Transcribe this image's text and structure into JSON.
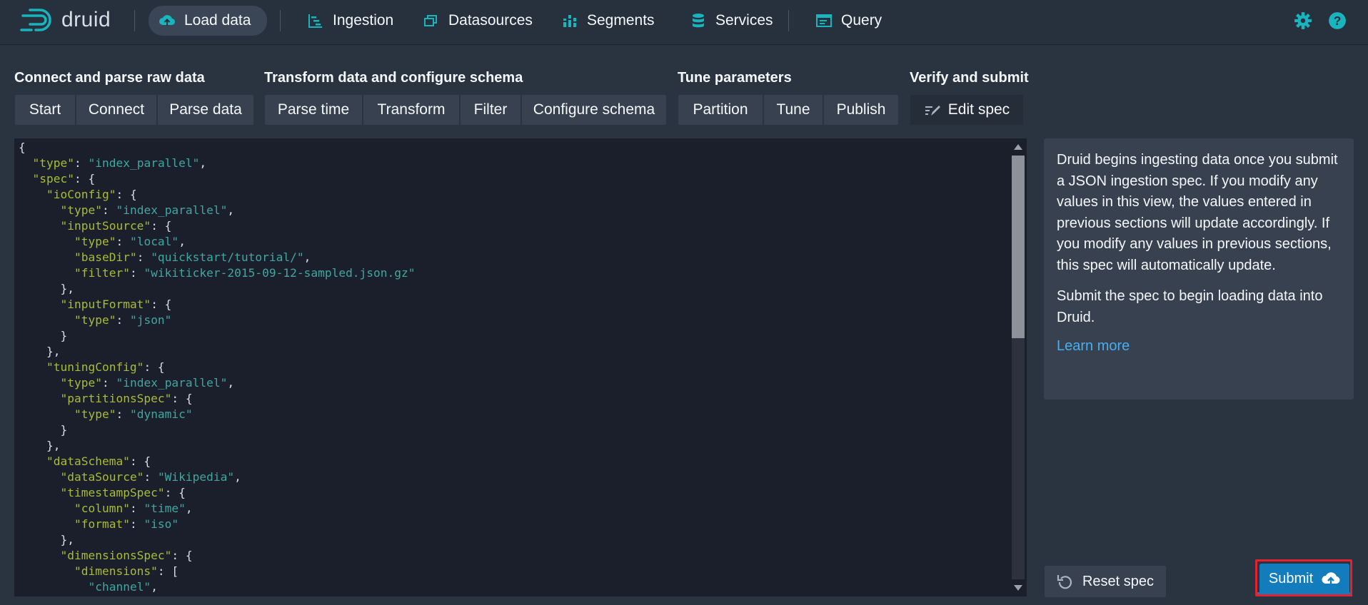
{
  "app": {
    "logo_text": "druid",
    "accent_color": "#48aff0",
    "teal_color": "#19b4bd"
  },
  "nav": {
    "load_data": "Load data",
    "ingestion": "Ingestion",
    "datasources": "Datasources",
    "segments": "Segments",
    "services": "Services",
    "query": "Query",
    "right_icons": [
      "gear-icon",
      "help-icon"
    ]
  },
  "steps": {
    "connect": {
      "title": "Connect and parse raw data",
      "buttons": [
        "Start",
        "Connect",
        "Parse data"
      ]
    },
    "transform": {
      "title": "Transform data and configure schema",
      "buttons": [
        "Parse time",
        "Transform",
        "Filter",
        "Configure schema"
      ]
    },
    "tune": {
      "title": "Tune parameters",
      "buttons": [
        "Partition",
        "Tune",
        "Publish"
      ]
    },
    "verify": {
      "title": "Verify and submit",
      "buttons": [
        "Edit spec"
      ]
    }
  },
  "editor": {
    "lines": [
      [
        [
          "p",
          "{"
        ]
      ],
      [
        [
          "p",
          "  "
        ],
        [
          "k",
          "\"type\""
        ],
        [
          "p",
          ": "
        ],
        [
          "s",
          "\"index_parallel\""
        ],
        [
          "p",
          ","
        ]
      ],
      [
        [
          "p",
          "  "
        ],
        [
          "k",
          "\"spec\""
        ],
        [
          "p",
          ": {"
        ]
      ],
      [
        [
          "p",
          "    "
        ],
        [
          "k",
          "\"ioConfig\""
        ],
        [
          "p",
          ": {"
        ]
      ],
      [
        [
          "p",
          "      "
        ],
        [
          "k",
          "\"type\""
        ],
        [
          "p",
          ": "
        ],
        [
          "s",
          "\"index_parallel\""
        ],
        [
          "p",
          ","
        ]
      ],
      [
        [
          "p",
          "      "
        ],
        [
          "k",
          "\"inputSource\""
        ],
        [
          "p",
          ": {"
        ]
      ],
      [
        [
          "p",
          "        "
        ],
        [
          "k",
          "\"type\""
        ],
        [
          "p",
          ": "
        ],
        [
          "s",
          "\"local\""
        ],
        [
          "p",
          ","
        ]
      ],
      [
        [
          "p",
          "        "
        ],
        [
          "k",
          "\"baseDir\""
        ],
        [
          "p",
          ": "
        ],
        [
          "s",
          "\"quickstart/tutorial/\""
        ],
        [
          "p",
          ","
        ]
      ],
      [
        [
          "p",
          "        "
        ],
        [
          "k",
          "\"filter\""
        ],
        [
          "p",
          ": "
        ],
        [
          "s",
          "\"wikiticker-2015-09-12-sampled.json.gz\""
        ]
      ],
      [
        [
          "p",
          "      },"
        ]
      ],
      [
        [
          "p",
          "      "
        ],
        [
          "k",
          "\"inputFormat\""
        ],
        [
          "p",
          ": {"
        ]
      ],
      [
        [
          "p",
          "        "
        ],
        [
          "k",
          "\"type\""
        ],
        [
          "p",
          ": "
        ],
        [
          "s",
          "\"json\""
        ]
      ],
      [
        [
          "p",
          "      }"
        ]
      ],
      [
        [
          "p",
          "    },"
        ]
      ],
      [
        [
          "p",
          "    "
        ],
        [
          "k",
          "\"tuningConfig\""
        ],
        [
          "p",
          ": {"
        ]
      ],
      [
        [
          "p",
          "      "
        ],
        [
          "k",
          "\"type\""
        ],
        [
          "p",
          ": "
        ],
        [
          "s",
          "\"index_parallel\""
        ],
        [
          "p",
          ","
        ]
      ],
      [
        [
          "p",
          "      "
        ],
        [
          "k",
          "\"partitionsSpec\""
        ],
        [
          "p",
          ": {"
        ]
      ],
      [
        [
          "p",
          "        "
        ],
        [
          "k",
          "\"type\""
        ],
        [
          "p",
          ": "
        ],
        [
          "s",
          "\"dynamic\""
        ]
      ],
      [
        [
          "p",
          "      }"
        ]
      ],
      [
        [
          "p",
          "    },"
        ]
      ],
      [
        [
          "p",
          "    "
        ],
        [
          "k",
          "\"dataSchema\""
        ],
        [
          "p",
          ": {"
        ]
      ],
      [
        [
          "p",
          "      "
        ],
        [
          "k",
          "\"dataSource\""
        ],
        [
          "p",
          ": "
        ],
        [
          "s",
          "\"Wikipedia\""
        ],
        [
          "p",
          ","
        ]
      ],
      [
        [
          "p",
          "      "
        ],
        [
          "k",
          "\"timestampSpec\""
        ],
        [
          "p",
          ": {"
        ]
      ],
      [
        [
          "p",
          "        "
        ],
        [
          "k",
          "\"column\""
        ],
        [
          "p",
          ": "
        ],
        [
          "s",
          "\"time\""
        ],
        [
          "p",
          ","
        ]
      ],
      [
        [
          "p",
          "        "
        ],
        [
          "k",
          "\"format\""
        ],
        [
          "p",
          ": "
        ],
        [
          "s",
          "\"iso\""
        ]
      ],
      [
        [
          "p",
          "      },"
        ]
      ],
      [
        [
          "p",
          "      "
        ],
        [
          "k",
          "\"dimensionsSpec\""
        ],
        [
          "p",
          ": {"
        ]
      ],
      [
        [
          "p",
          "        "
        ],
        [
          "k",
          "\"dimensions\""
        ],
        [
          "p",
          ": ["
        ]
      ],
      [
        [
          "p",
          "          "
        ],
        [
          "s",
          "\"channel\""
        ],
        [
          "p",
          ","
        ]
      ]
    ],
    "scroll_position": 0
  },
  "info": {
    "paragraph1": "Druid begins ingesting data once you submit a JSON ingestion spec. If you modify any values in this view, the values entered in previous sections will update accordingly. If you modify any values in previous sections, this spec will automatically update.",
    "paragraph2": "Submit the spec to begin loading data into Druid.",
    "learn_more": "Learn more"
  },
  "actions": {
    "reset_spec": "Reset spec",
    "submit": "Submit"
  }
}
